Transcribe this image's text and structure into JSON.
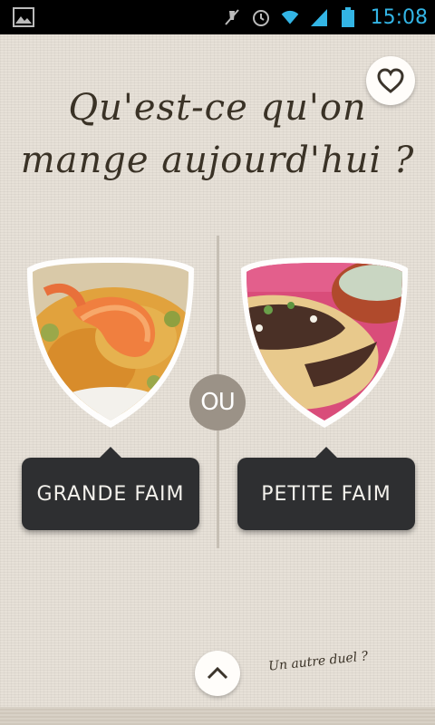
{
  "status_bar": {
    "time": "15:08",
    "icons": [
      "gallery-notification-icon",
      "mute-icon",
      "alarm-icon",
      "wifi-icon",
      "signal-icon",
      "battery-icon"
    ]
  },
  "header": {
    "title_line1": "Qu'est-ce qu'on",
    "title_line2": "mange aujourd'hui ?"
  },
  "favorite": {
    "icon": "heart-icon"
  },
  "choices": {
    "separator": "OU",
    "left": {
      "label": "GRANDE FAIM",
      "image": "shrimp paella"
    },
    "right": {
      "label": "PETITE FAIM",
      "image": "meat flatbread"
    }
  },
  "footer": {
    "up_icon": "chevron-up-icon",
    "other_duel": "Un autre duel ?"
  },
  "colors": {
    "background": "#e7e1d8",
    "button": "#2e2f31",
    "separator": "#9b9287",
    "statusbar_accent": "#33b5e5",
    "headline": "#3a3226"
  }
}
